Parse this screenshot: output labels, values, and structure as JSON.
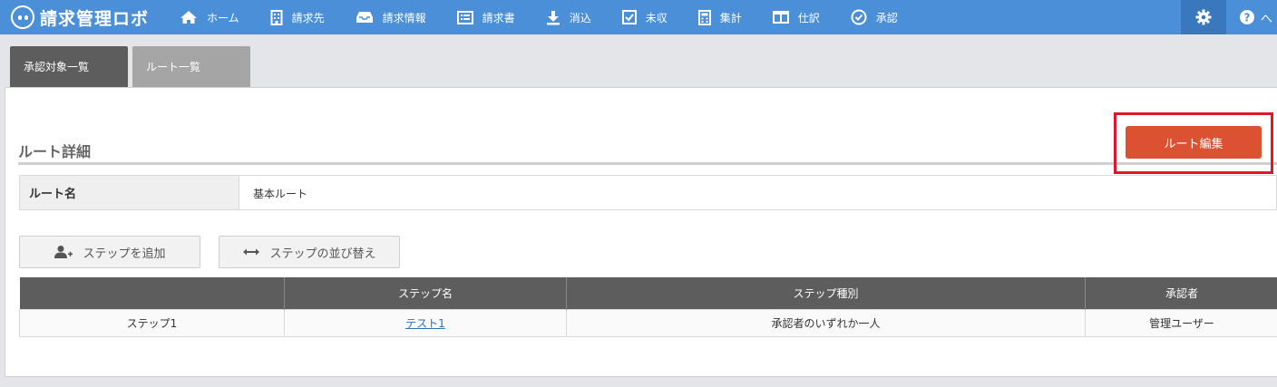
{
  "app": {
    "logo_text": "請求管理ロボ"
  },
  "nav": {
    "items": [
      {
        "label": "ホーム",
        "icon": "home-icon"
      },
      {
        "label": "請求先",
        "icon": "building-icon"
      },
      {
        "label": "請求情報",
        "icon": "tray-icon"
      },
      {
        "label": "請求書",
        "icon": "invoice-list-icon"
      },
      {
        "label": "消込",
        "icon": "download-icon"
      },
      {
        "label": "未収",
        "icon": "checkbox-icon"
      },
      {
        "label": "集計",
        "icon": "calculator-icon"
      },
      {
        "label": "仕訳",
        "icon": "columns-icon"
      },
      {
        "label": "承認",
        "icon": "check-circle-icon"
      }
    ],
    "help_label": "へ"
  },
  "tabs": [
    {
      "label": "承認対象一覧",
      "active": true
    },
    {
      "label": "ルート一覧",
      "active": false
    }
  ],
  "section": {
    "title": "ルート詳細",
    "edit_button_label": "ルート編集"
  },
  "route": {
    "name_label": "ルート名",
    "name_value": "基本ルート"
  },
  "actions": {
    "add_step_label": "ステップを追加",
    "sort_steps_label": "ステップの並び替え"
  },
  "table": {
    "headers": [
      "",
      "ステップ名",
      "ステップ種別",
      "承認者"
    ],
    "rows": [
      [
        "ステップ1",
        "テスト1",
        "承認者のいずれか一人",
        "管理ユーザー"
      ]
    ]
  },
  "colors": {
    "header_bg": "#4a8fd8",
    "accent_button": "#dd5133",
    "highlight_box": "#e0162b",
    "table_header": "#5d5d5d"
  }
}
